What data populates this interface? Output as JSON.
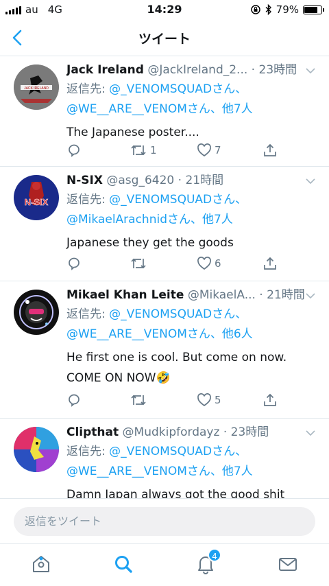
{
  "status_bar": {
    "carrier": "au",
    "network": "4G",
    "time": "14:29",
    "battery": "79%",
    "battery_level": 0.79
  },
  "nav": {
    "title": "ツイート"
  },
  "tweets": [
    {
      "name": "Jack Ireland",
      "handle": "@JackIreland_2...",
      "sep": " · ",
      "time": "23時間",
      "reply_prefix": "返信先: ",
      "reply_line1": "@_VENOMSQUADさん、",
      "reply_line2": "@WE__ARE__VENOMさん、他7人",
      "text": "The Japanese poster....",
      "retweets": "1",
      "likes": "7",
      "avatar_label": "JACK IRELAND"
    },
    {
      "name": "N-SIX",
      "handle": "@asg_6420",
      "sep": " · ",
      "time": "21時間",
      "reply_prefix": "返信先: ",
      "reply_line1": "@_VENOMSQUADさん、",
      "reply_line2": "@MikaelArachnidさん、他7人",
      "text": "Japanese they get the goods",
      "retweets": "",
      "likes": "6",
      "avatar_label": "N-SIX"
    },
    {
      "name": "Mikael Khan Leite",
      "handle": "@MikaelA...",
      "sep": " · ",
      "time": "21時間",
      "reply_prefix": "返信先: ",
      "reply_line1": "@_VENOMSQUADさん、",
      "reply_line2": "@WE__ARE__VENOMさん、他6人",
      "text_line1": "He first one is cool. But come on now.",
      "text_line2": "COME ON NOW🤣",
      "retweets": "",
      "likes": "5"
    },
    {
      "name": "Clipthat",
      "handle": "@Mudkipfordayz",
      "sep": " · ",
      "time": "23時間",
      "reply_prefix": "返信先: ",
      "reply_line1": "@_VENOMSQUADさん、",
      "reply_line2": "@WE__ARE__VENOMさん、他7人",
      "text": "Damn Japan always got the good shit"
    }
  ],
  "composer": {
    "placeholder": "返信をツイート"
  },
  "tabbar": {
    "notifications_badge": "4"
  },
  "colors": {
    "accent": "#1da1f2",
    "muted": "#657786",
    "divider": "#e1e8ed"
  }
}
